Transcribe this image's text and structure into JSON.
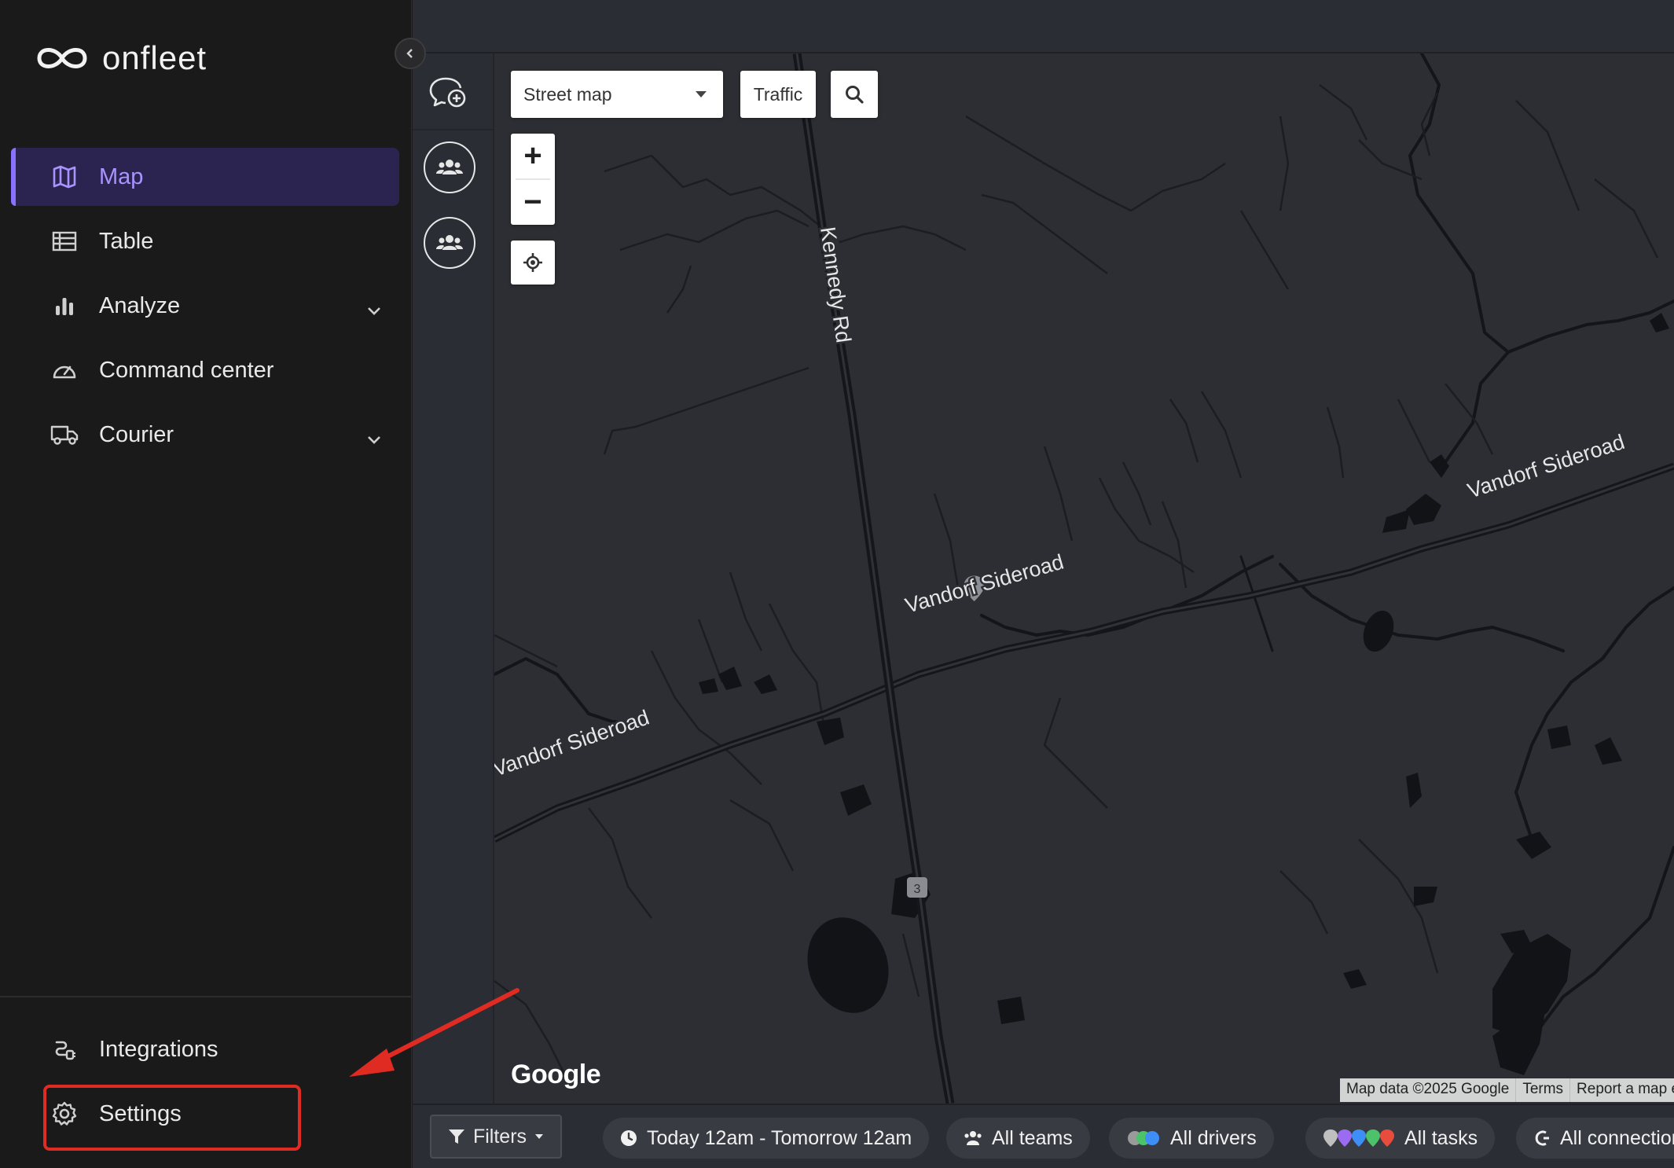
{
  "brand": {
    "name": "onfleet"
  },
  "sidebar": {
    "items": [
      {
        "label": "Map",
        "icon": "map-icon",
        "active": true
      },
      {
        "label": "Table",
        "icon": "table-icon"
      },
      {
        "label": "Analyze",
        "icon": "bar-chart-icon",
        "expandable": true
      },
      {
        "label": "Command center",
        "icon": "gauge-icon"
      },
      {
        "label": "Courier",
        "icon": "truck-icon",
        "expandable": true
      }
    ],
    "bottom_items": [
      {
        "label": "Integrations",
        "icon": "integrations-icon"
      },
      {
        "label": "Settings",
        "icon": "gear-icon",
        "highlighted": true
      }
    ]
  },
  "map": {
    "type_select": "Street map",
    "traffic_label": "Traffic",
    "zoom_in": "+",
    "zoom_out": "−",
    "roads": {
      "kennedy": "Kennedy Rd",
      "vandorf_left": "Vandorf Sideroad",
      "vandorf_mid": "Vandorf Sideroad",
      "vandorf_right": "Vandorf Sideroad",
      "shield": "3"
    },
    "google_logo": "Google",
    "attribution": [
      "Map data ©2025 Google",
      "Terms",
      "Report a map error"
    ]
  },
  "filters": {
    "filters_label": "Filters",
    "time_range": "Today 12am - Tomorrow 12am",
    "teams": "All teams",
    "drivers": "All drivers",
    "tasks": "All tasks",
    "connections": "All connections"
  },
  "colors": {
    "accent": "#8a71ff",
    "active_bg": "#2c2450",
    "highlight_red": "#e02b22",
    "map_bg": "#2c2e33"
  }
}
